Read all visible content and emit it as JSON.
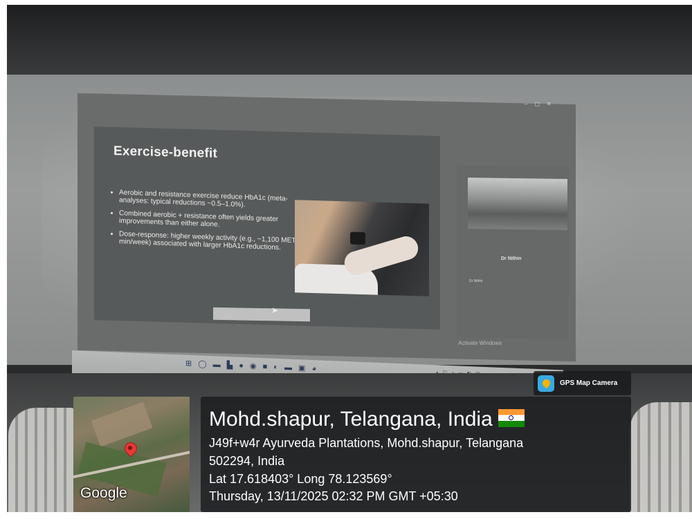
{
  "slide": {
    "title": "Exercise-benefit",
    "bullets": [
      "Aerobic and resistance exercise reduce HbA1c (meta-analyses: typical reductions ~0.5–1.0%).",
      "Combined aerobic + resistance often yields greater improvements than either alone.",
      "Dose-response: higher weekly activity (e.g., ~1,100 MET-min/week) associated with larger HbA1c reductions."
    ]
  },
  "meeting": {
    "participant_name": "Dr Nithin",
    "participant_small": "Dr Nithin",
    "activate_windows": "Activate Windows"
  },
  "gps": {
    "badge_label": "GPS Map Camera",
    "map_attribution": "Google",
    "place_title": "Mohd.shapur, Telangana, India",
    "address_line1": "J49f+w4r Ayurveda Plantations, Mohd.shapur, Telangana",
    "address_line2": "502294, India",
    "coordinates": "Lat 17.618403° Long 78.123569°",
    "datetime": "Thursday, 13/11/2025 02:32 PM GMT +05:30"
  },
  "icons": {
    "gps_logo": "gps-map-camera-icon",
    "map_pin": "map-pin-icon",
    "flag": "india-flag-icon"
  },
  "colors": {
    "panel_bg": "#1c1e21",
    "pin_red": "#e53935",
    "gps_logo_blue": "#3aa9e0"
  }
}
